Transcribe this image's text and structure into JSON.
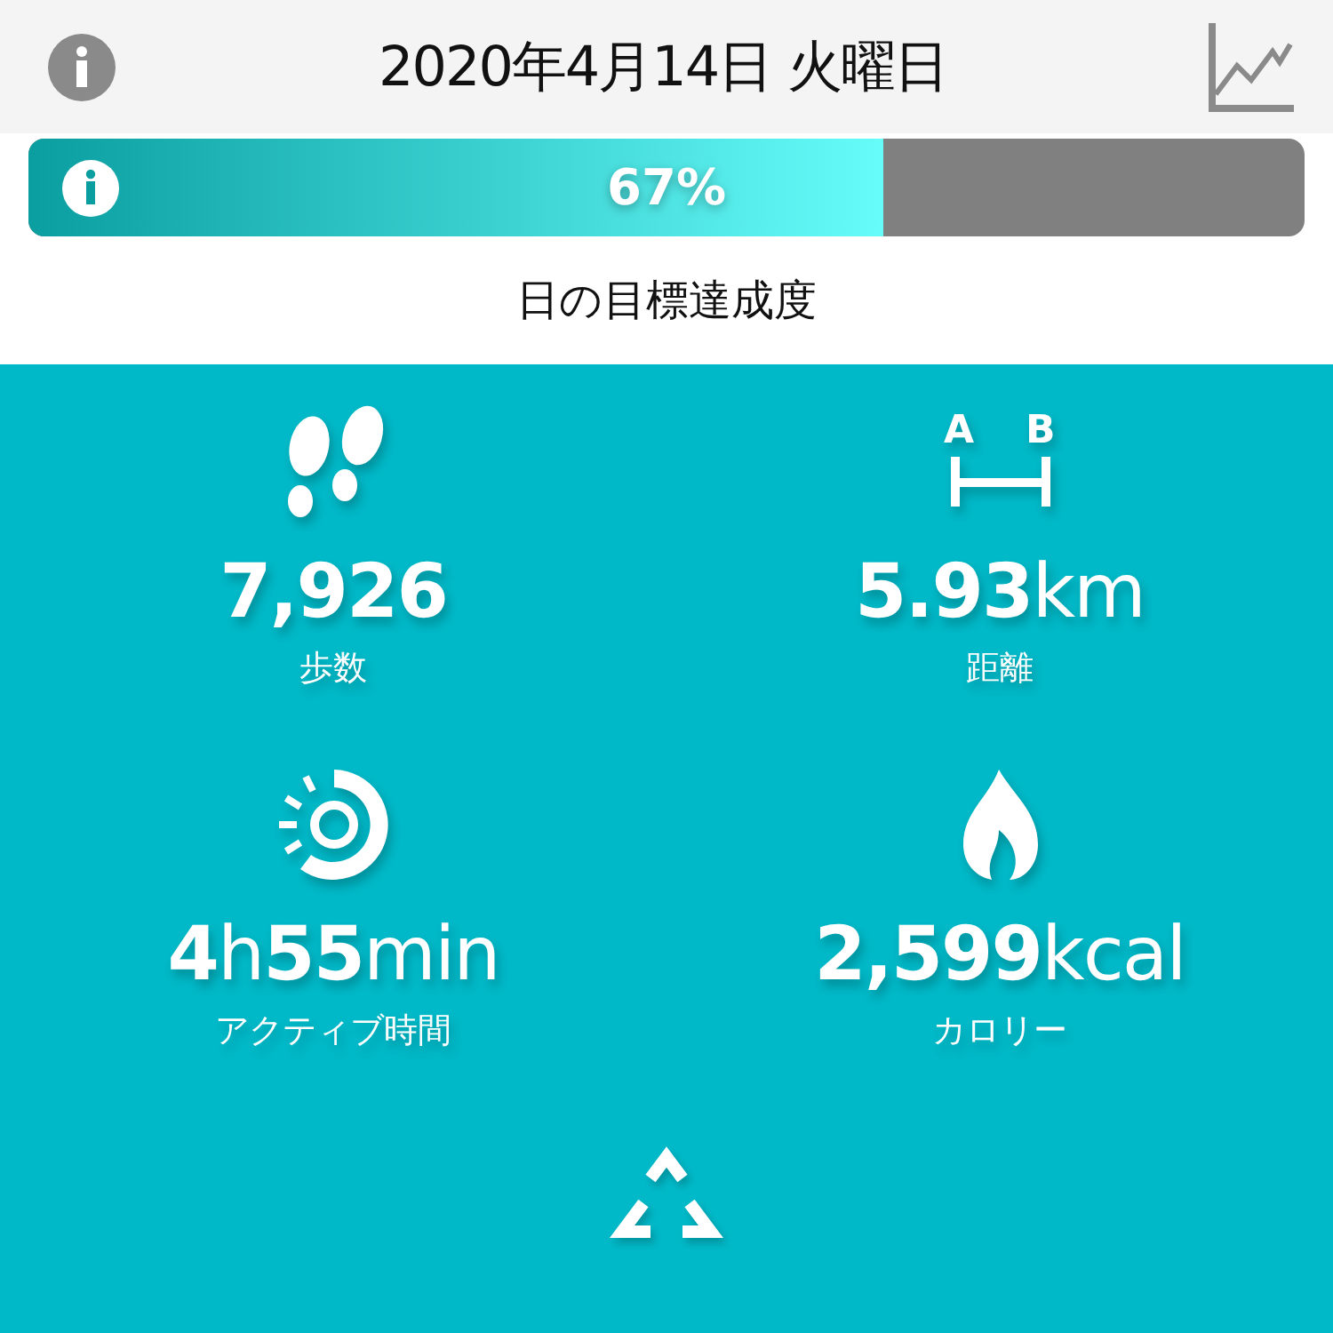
{
  "header": {
    "title": "2020年4月14日 火曜日"
  },
  "goal": {
    "level": 0.67,
    "reading": "67%",
    "label": "日の目標達成度"
  },
  "metric_rows": [
    {
      "icon_letters": [
        "A",
        "B"
      ],
      "metrics": [
        {
          "kind": "steps",
          "number": "7,926",
          "label": "歩数"
        },
        {
          "kind": "distance",
          "number": "5.93",
          "unit": "km",
          "label": "距離"
        }
      ]
    },
    {
      "metrics": [
        {
          "kind": "active",
          "number": "4",
          "unit": "h",
          "number_2": "55",
          "unit_2": "min",
          "label": "アクティブ時間"
        },
        {
          "kind": "calories",
          "number": "2,599",
          "unit": "kcal",
          "label": "カロリー"
        }
      ]
    }
  ]
}
